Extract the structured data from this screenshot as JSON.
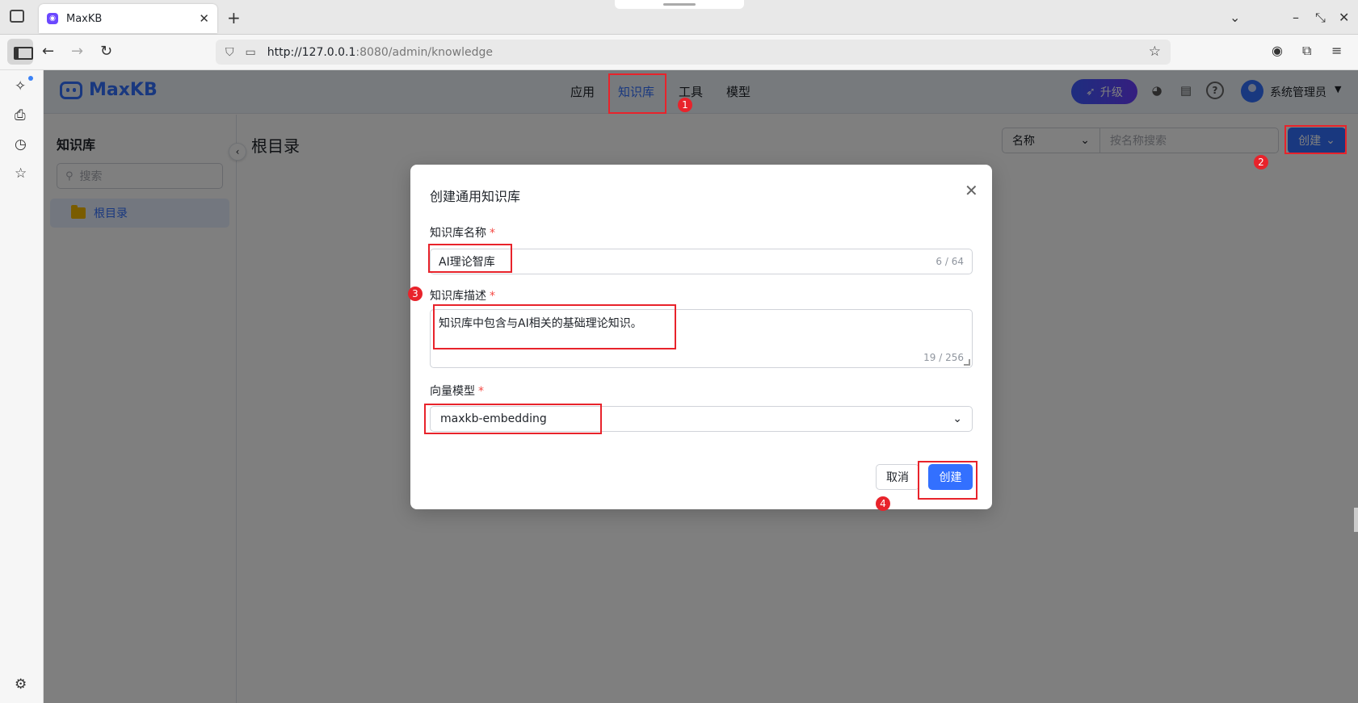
{
  "browser": {
    "tab_title": "MaxKB",
    "tab_close": "✕",
    "new_tab": "+",
    "url_host": "http://127.0.0.1",
    "url_rest": ":8080/admin/knowledge"
  },
  "app": {
    "logo_text": "MaxKB",
    "nav": [
      "应用",
      "知识库",
      "工具",
      "模型"
    ],
    "upgrade_label": "升级",
    "username": "系统管理员"
  },
  "sidebar": {
    "title": "知识库",
    "search_placeholder": "搜索",
    "root_item": "根目录"
  },
  "main": {
    "title": "根目录",
    "filter_field": "名称",
    "search_placeholder": "按名称搜索",
    "create_label": "创建"
  },
  "dialog": {
    "title": "创建通用知识库",
    "name_label": "知识库名称",
    "name_value": "AI理论智库",
    "name_count": "6 / 64",
    "desc_label": "知识库描述",
    "desc_value": "知识库中包含与AI相关的基础理论知识。",
    "desc_count": "19 / 256",
    "model_label": "向量模型",
    "model_value": "maxkb-embedding",
    "cancel_label": "取消",
    "create_label": "创建",
    "required_mark": "*"
  },
  "annotations": [
    "1",
    "2",
    "3",
    "4"
  ],
  "colors": {
    "primary": "#3370ff",
    "annotation_red": "#e8232b"
  }
}
